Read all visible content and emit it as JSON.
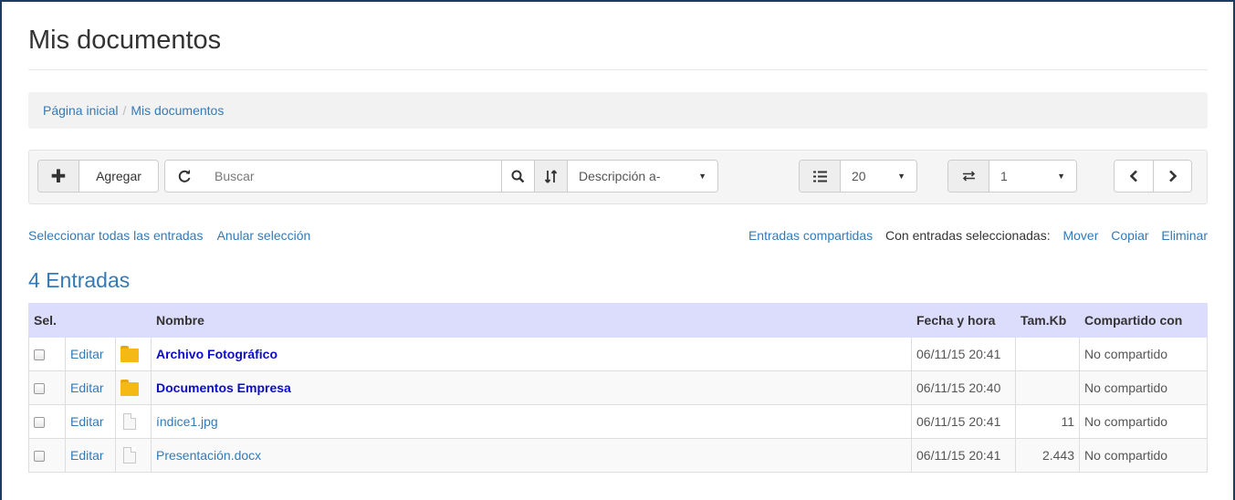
{
  "page": {
    "title": "Mis documentos"
  },
  "breadcrumb": {
    "home": "Página inicial",
    "separator": "/",
    "current": "Mis documentos"
  },
  "toolbar": {
    "add_label": "Agregar",
    "search_placeholder": "Buscar",
    "sort_value": "Descripción a-",
    "page_size_value": "20",
    "page_value": "1"
  },
  "selection": {
    "select_all": "Seleccionar todas las entradas",
    "deselect": "Anular selección"
  },
  "actions": {
    "shared": "Entradas compartidas",
    "with_selected": "Con entradas seleccionadas:",
    "move": "Mover",
    "copy": "Copiar",
    "delete": "Eliminar"
  },
  "list": {
    "count_label": "4 Entradas",
    "columns": {
      "sel": "Sel.",
      "name": "Nombre",
      "date": "Fecha y hora",
      "size": "Tam.Kb",
      "shared": "Compartido con"
    },
    "rows": [
      {
        "edit": "Editar",
        "type": "folder",
        "name": "Archivo Fotográfico",
        "date": "06/11/15 20:41",
        "size": "",
        "shared": "No compartido"
      },
      {
        "edit": "Editar",
        "type": "folder",
        "name": "Documentos Empresa",
        "date": "06/11/15 20:40",
        "size": "",
        "shared": "No compartido"
      },
      {
        "edit": "Editar",
        "type": "file",
        "name": "índice1.jpg",
        "date": "06/11/15 20:41",
        "size": "11",
        "shared": "No compartido"
      },
      {
        "edit": "Editar",
        "type": "file",
        "name": "Presentación.docx",
        "date": "06/11/15 20:41",
        "size": "2.443",
        "shared": "No compartido"
      }
    ]
  },
  "colors": {
    "link": "#337ab7",
    "folder_link": "#0b0bcc",
    "header_bg": "#dcdcfc",
    "folder": "#f5b915"
  },
  "icons": [
    "plus-icon",
    "refresh-icon",
    "search-icon",
    "sort-icon",
    "list-icon",
    "exchange-icon",
    "chevron-left-icon",
    "chevron-right-icon",
    "folder-icon",
    "file-icon"
  ]
}
